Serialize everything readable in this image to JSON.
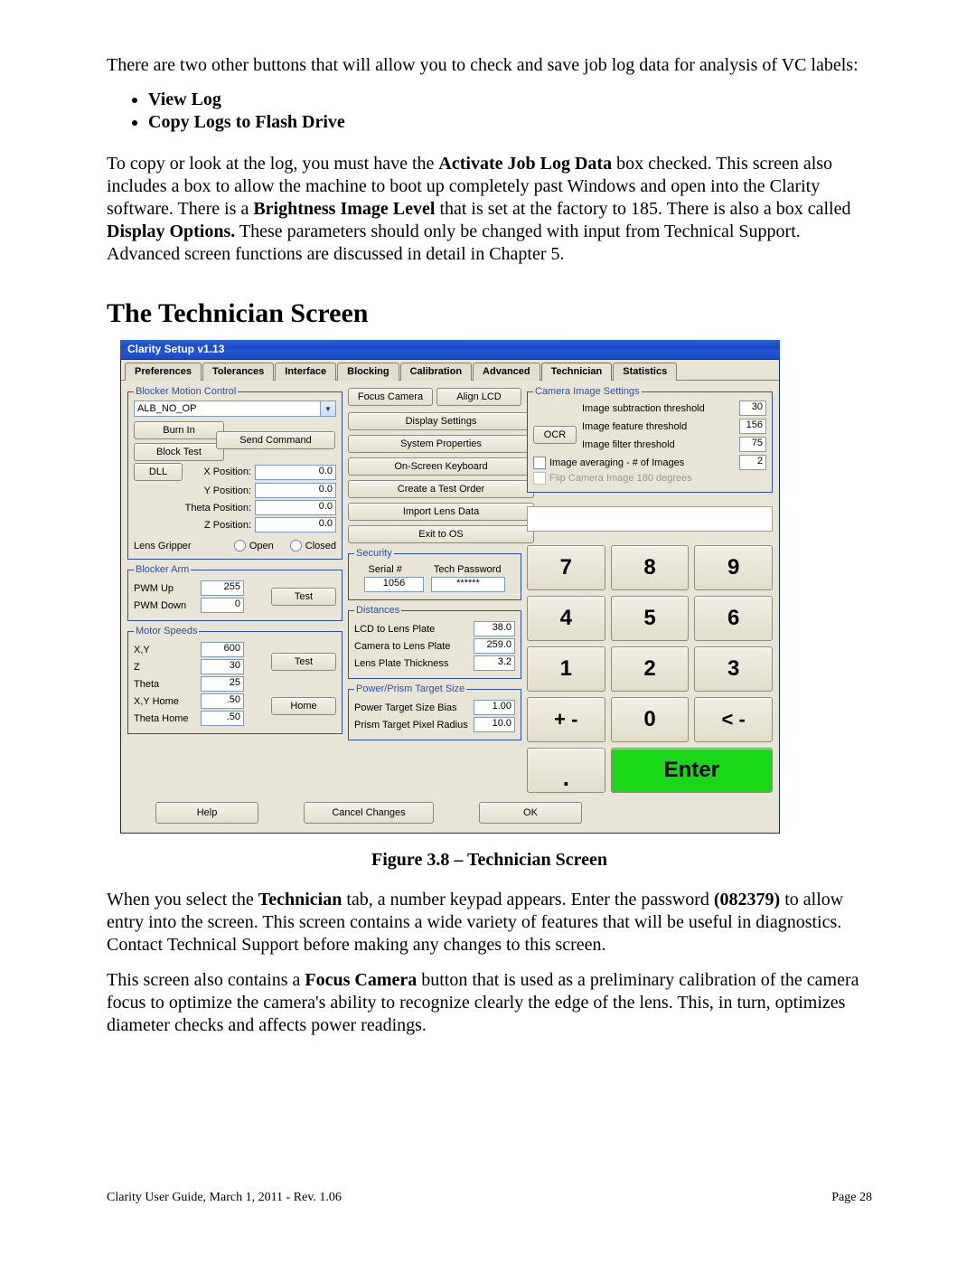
{
  "intro_text": "There are two other buttons that will allow you to check and save job log data for analysis of VC labels:",
  "bullets": [
    "View Log",
    "Copy Logs to Flash Drive"
  ],
  "para2": {
    "pre": "To copy or look at the log, you must have the ",
    "b1": "Activate Job Log Data",
    "mid1": " box checked.  This screen also includes a box to allow the machine to boot up completely past Windows and open into the Clarity software.  There is a ",
    "b2": "Brightness Image Level",
    "mid2": " that is set at the factory to 185.  There is also a box called ",
    "b3": "Display Options.",
    "post": "  These parameters should only be changed with input from Technical Support.  Advanced screen functions are discussed in detail in Chapter 5."
  },
  "section_title": "The Technician Screen",
  "figure_caption": "Figure 3.8 – Technician Screen",
  "para3": {
    "pre": "When you select the ",
    "b1": "Technician",
    "mid1": " tab, a number keypad appears.  Enter the password ",
    "b2": "(082379)",
    "post": " to allow entry into the screen.  This screen contains a wide variety of features that will be useful in diagnostics.  Contact Technical Support before making any changes to this screen."
  },
  "para4": {
    "pre": "This screen also contains a ",
    "b1": "Focus Camera",
    "post": " button that is used as a preliminary calibration of the camera focus to optimize the camera's ability to recognize clearly the edge of the lens.  This, in turn, optimizes diameter checks and affects power readings."
  },
  "footer_left": "Clarity User Guide, March 1, 2011 - Rev. 1.06",
  "footer_right": "Page 28",
  "window": {
    "title": "Clarity Setup v1.13",
    "tabs": [
      "Preferences",
      "Tolerances",
      "Interface",
      "Blocking",
      "Calibration",
      "Advanced",
      "Technician",
      "Statistics"
    ],
    "active_tab_index": 6,
    "blocker_motion": {
      "legend": "Blocker Motion Control",
      "command": "ALB_NO_OP",
      "burn_in": "Burn In",
      "block_test": "Block Test",
      "send_command": "Send Command",
      "dll": "DLL",
      "xpos_lbl": "X Position:",
      "ypos_lbl": "Y Position:",
      "theta_lbl": "Theta Position:",
      "zpos_lbl": "Z Position:",
      "xpos": "0.0",
      "ypos": "0.0",
      "theta": "0.0",
      "zpos": "0.0",
      "gripper_lbl": "Lens Gripper",
      "open": "Open",
      "closed": "Closed"
    },
    "blocker_arm": {
      "legend": "Blocker Arm",
      "pwm_up_lbl": "PWM Up",
      "pwm_down_lbl": "PWM Down",
      "pwm_up": "255",
      "pwm_down": "0",
      "test": "Test"
    },
    "motor_speeds": {
      "legend": "Motor Speeds",
      "xy_lbl": "X,Y",
      "xy": "600",
      "z_lbl": "Z",
      "z": "30",
      "theta_lbl": "Theta",
      "theta": "25",
      "xyh_lbl": "X,Y Home",
      "xyh": ".50",
      "th_lbl": "Theta Home",
      "th": ".50",
      "test": "Test",
      "home": "Home"
    },
    "mid_buttons": {
      "focus": "Focus Camera",
      "align": "Align LCD",
      "display": "Display Settings",
      "sysprops": "System Properties",
      "osk": "On-Screen Keyboard",
      "testorder": "Create a Test Order",
      "importlens": "Import Lens Data",
      "exit": "Exit to OS"
    },
    "security": {
      "legend": "Security",
      "serial_lbl": "Serial #",
      "pw_lbl": "Tech Password",
      "serial": "1056",
      "pw": "******"
    },
    "distances": {
      "legend": "Distances",
      "lcd_lbl": "LCD to Lens Plate",
      "lcd": "38.0",
      "cam_lbl": "Camera to Lens Plate",
      "cam": "259.0",
      "thk_lbl": "Lens Plate Thickness",
      "thk": "3.2"
    },
    "power_prism": {
      "legend": "Power/Prism Target Size",
      "bias_lbl": "Power Target Size Bias",
      "bias": "1.00",
      "rad_lbl": "Prism Target Pixel Radius",
      "rad": "10.0"
    },
    "camera": {
      "legend": "Camera Image Settings",
      "sub_lbl": "Image subtraction threshold",
      "sub": "30",
      "feat_lbl": "Image feature threshold",
      "feat": "156",
      "filt_lbl": "Image filter threshold",
      "filt": "75",
      "avg_lbl": "Image averaging - # of Images",
      "avg": "2",
      "flip_lbl": "Flip Camera Image 180 degrees",
      "ocr": "OCR"
    },
    "keypad": {
      "k7": "7",
      "k8": "8",
      "k9": "9",
      "k4": "4",
      "k5": "5",
      "k6": "6",
      "k1": "1",
      "k2": "2",
      "k3": "3",
      "pm": "+ -",
      "k0": "0",
      "back": "< -",
      "dot": ".",
      "enter": "Enter"
    },
    "bottom": {
      "help": "Help",
      "cancel": "Cancel Changes",
      "ok": "OK"
    }
  }
}
